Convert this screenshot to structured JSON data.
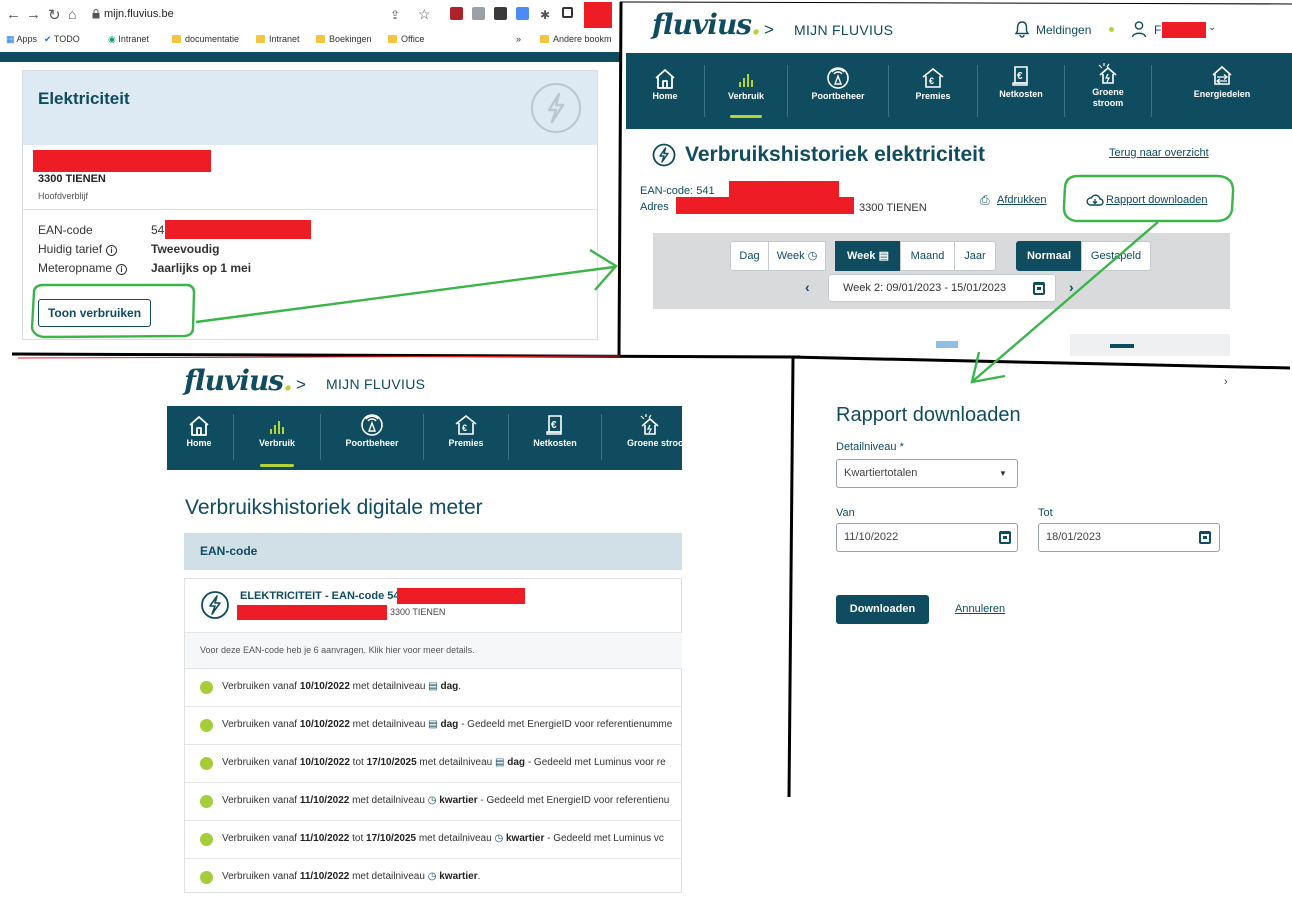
{
  "browser": {
    "url": "mijn.fluvius.be",
    "bookmarks": [
      "Apps",
      "TODO",
      "Intranet",
      "documentatie",
      "Intranet",
      "Boekingen",
      "Office",
      "»",
      "Andere bookm"
    ]
  },
  "card": {
    "title": "Elektriciteit",
    "city": "3300 TIENEN",
    "residence": "Hoofdverblijf",
    "ean_label": "EAN-code",
    "ean_value": "54",
    "tariff_label": "Huidig tarief",
    "tariff_value": "Tweevoudig",
    "meter_label": "Meteropname",
    "meter_value": "Jaarlijks op 1 mei",
    "button": "Toon verbruiken"
  },
  "header": {
    "logo": "fluvius",
    "breadcrumb": "MIJN FLUVIUS",
    "notifications": "Meldingen",
    "user_initial": "F"
  },
  "nav": {
    "items": [
      "Home",
      "Verbruik",
      "Poortbeheer",
      "Premies",
      "Netkosten",
      "Groene stroom",
      "Energiedelen"
    ],
    "active": "Verbruik"
  },
  "history": {
    "title": "Verbruikshistoriek elektriciteit",
    "back_link": "Terug naar overzicht",
    "ean_label": "EAN-code: 541",
    "address_label": "Adres",
    "address_city": "3300 TIENEN",
    "print": "Afdrukken",
    "download": "Rapport downloaden",
    "periods": [
      "Dag",
      "Week",
      "Week",
      "Maand",
      "Jaar"
    ],
    "modes": [
      "Normaal",
      "Gestapeld"
    ],
    "week_range": "Week 2: 09/01/2023 - 15/01/2023"
  },
  "digital": {
    "title": "Verbruikshistoriek digitale meter",
    "column": "EAN-code",
    "ean_title": "ELEKTRICITEIT - EAN-code 54",
    "city": "3300 TIENEN",
    "notice": "Voor deze EAN-code heb je 6 aanvragen. Klik hier voor meer details.",
    "requests": [
      {
        "from": "10/10/2022",
        "to": "",
        "level": "dag",
        "suffix": "."
      },
      {
        "from": "10/10/2022",
        "to": "",
        "level": "dag",
        "suffix": " - Gedeeld met EnergieID voor referentienumme"
      },
      {
        "from": "10/10/2022",
        "to": "17/10/2025",
        "level": "dag",
        "suffix": " - Gedeeld met Luminus voor re"
      },
      {
        "from": "11/10/2022",
        "to": "",
        "level": "kwartier",
        "suffix": " - Gedeeld met EnergieID voor referentienu"
      },
      {
        "from": "11/10/2022",
        "to": "17/10/2025",
        "level": "kwartier",
        "suffix": " - Gedeeld met Luminus vc"
      },
      {
        "from": "11/10/2022",
        "to": "",
        "level": "kwartier",
        "suffix": "."
      }
    ],
    "req_prefix": "Verbruiken vanaf",
    "req_to": "tot",
    "req_mid": "met detailniveau"
  },
  "dialog": {
    "title": "Rapport downloaden",
    "level_label": "Detailniveau *",
    "level_value": "Kwartiertotalen",
    "from_label": "Van",
    "from_value": "11/10/2022",
    "to_label": "Tot",
    "to_value": "18/01/2023",
    "submit": "Downloaden",
    "cancel": "Annuleren"
  },
  "colors": {
    "brand": "#0f4c5f",
    "accent": "#b6d334",
    "annotation": "#3bb54a",
    "redaction": "#ee1c25"
  }
}
